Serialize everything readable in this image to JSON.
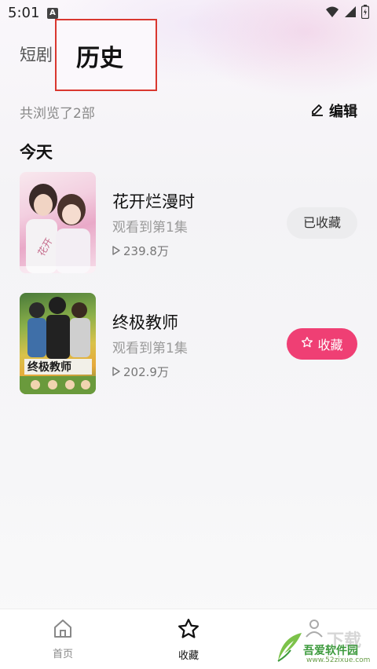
{
  "status_bar": {
    "time": "5:01",
    "app_badge": "A"
  },
  "header": {
    "tab_short_drama": "短剧",
    "tab_history": "历史"
  },
  "summary": {
    "browsed_text": "共浏览了2部",
    "edit_label": "编辑"
  },
  "section": {
    "today": "今天"
  },
  "items": [
    {
      "title": "花开烂漫时",
      "progress": "观看到第1集",
      "plays": "239.8万",
      "action": "已收藏"
    },
    {
      "title": "终极教师",
      "progress": "观看到第1集",
      "plays": "202.9万",
      "action": "收藏"
    }
  ],
  "bottom_nav": {
    "home": "首页",
    "favorites": "收藏"
  },
  "watermark": {
    "text": "吾爱软件园",
    "url": "www.52zixue.com",
    "tiny": "下载"
  },
  "colors": {
    "accent_pink": "#ef3f74",
    "highlight_box_red": "#d9372f"
  }
}
